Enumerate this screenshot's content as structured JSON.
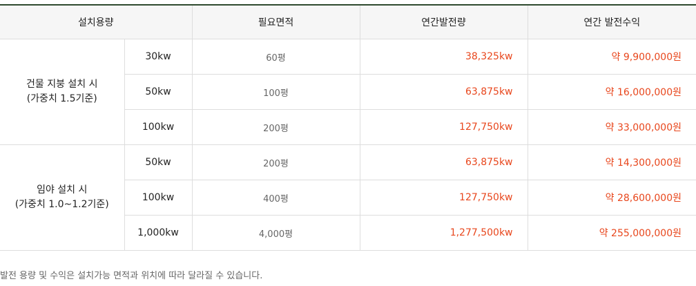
{
  "table": {
    "headers": [
      "설치용량",
      "필요면적",
      "연간발전량",
      "연간 발전수익"
    ],
    "groups": [
      {
        "label_line1": "건물 지붕 설치 시",
        "label_line2": "(가중치 1.5기준)",
        "rows": [
          {
            "capacity": "30kw",
            "area": "60평",
            "annual_generation": "38,325kw",
            "annual_revenue": "약 9,900,000원"
          },
          {
            "capacity": "50kw",
            "area": "100평",
            "annual_generation": "63,875kw",
            "annual_revenue": "약 16,000,000원"
          },
          {
            "capacity": "100kw",
            "area": "200평",
            "annual_generation": "127,750kw",
            "annual_revenue": "약 33,000,000원"
          }
        ]
      },
      {
        "label_line1": "임야 설치 시",
        "label_line2": "(가중치 1.0~1.2기준)",
        "rows": [
          {
            "capacity": "50kw",
            "area": "200평",
            "annual_generation": "63,875kw",
            "annual_revenue": "약 14,300,000원"
          },
          {
            "capacity": "100kw",
            "area": "400평",
            "annual_generation": "127,750kw",
            "annual_revenue": "약 28,600,000원"
          },
          {
            "capacity": "1,000kw",
            "area": "4,000평",
            "annual_generation": "1,277,500kw",
            "annual_revenue": "약 255,000,000원"
          }
        ]
      }
    ]
  },
  "note": "발전 용량 및 수익은 설치가능 면적과 위치에 따라 달라질 수 있습니다.",
  "colors": {
    "accent_rule": "#2e4a2e",
    "highlight_value": "#e8461c",
    "header_bg": "#f6f6f6"
  }
}
